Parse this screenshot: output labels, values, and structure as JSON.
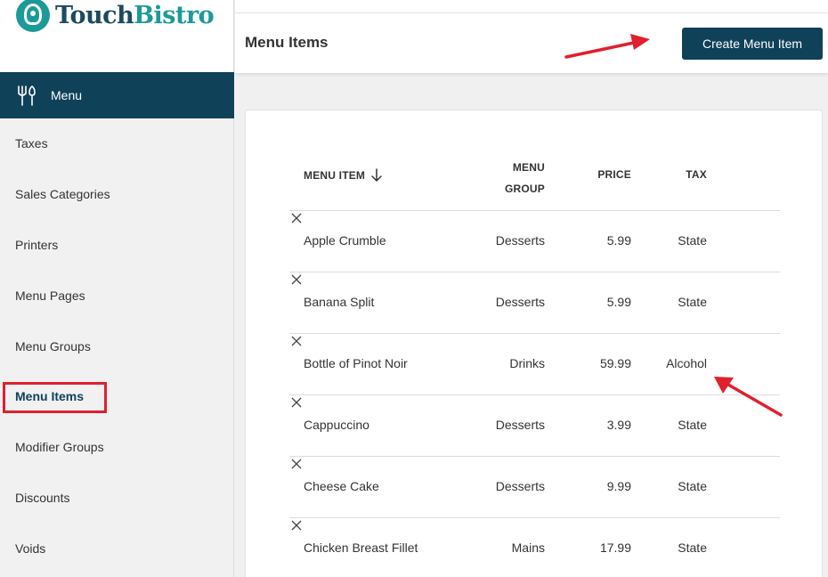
{
  "brand": {
    "name_part1": "Touch",
    "name_part2": "Bistro",
    "accent": "#1c9a98",
    "dark": "#0f4159"
  },
  "sidebar": {
    "section_label": "Menu",
    "items": [
      {
        "label": "Taxes"
      },
      {
        "label": "Sales Categories"
      },
      {
        "label": "Printers"
      },
      {
        "label": "Menu Pages"
      },
      {
        "label": "Menu Groups"
      },
      {
        "label": "Menu Items",
        "active": true
      },
      {
        "label": "Modifier Groups"
      },
      {
        "label": "Discounts"
      },
      {
        "label": "Voids"
      }
    ]
  },
  "header": {
    "title": "Menu Items",
    "create_button": "Create Menu Item"
  },
  "table": {
    "headers": {
      "item": "MENU ITEM",
      "group_line1": "MENU",
      "group_line2": "GROUP",
      "price": "PRICE",
      "tax": "TAX"
    },
    "rows": [
      {
        "name": "Apple Crumble",
        "group": "Desserts",
        "price": "5.99",
        "tax": "State"
      },
      {
        "name": "Banana Split",
        "group": "Desserts",
        "price": "5.99",
        "tax": "State"
      },
      {
        "name": "Bottle of Pinot Noir",
        "group": "Drinks",
        "price": "59.99",
        "tax": "Alcohol"
      },
      {
        "name": "Cappuccino",
        "group": "Desserts",
        "price": "3.99",
        "tax": "State"
      },
      {
        "name": "Cheese Cake",
        "group": "Desserts",
        "price": "9.99",
        "tax": "State"
      },
      {
        "name": "Chicken Breast Fillet",
        "group": "Mains",
        "price": "17.99",
        "tax": "State"
      }
    ]
  },
  "annotations": {
    "color": "#e0202e"
  }
}
